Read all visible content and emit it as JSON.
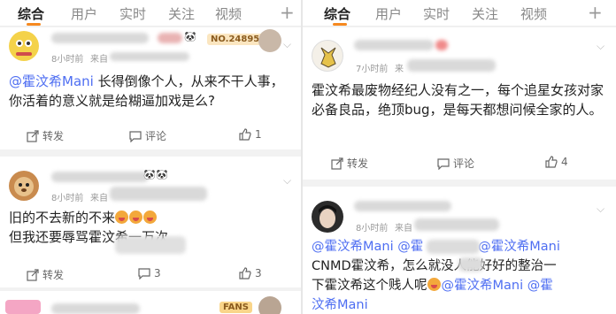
{
  "tabs": [
    "综合",
    "用户",
    "实时",
    "关注",
    "视频"
  ],
  "plus_label": "+",
  "left": {
    "post1": {
      "badge": "NO.248957",
      "time": "8小时前",
      "source": "来自",
      "mention": "@霍汶希Mani",
      "text": " 长得倒像个人，从来不干人事，你活着的意义就是给糊逼加戏是么?",
      "repost": "转发",
      "comment": "评论",
      "likes": "1"
    },
    "post2": {
      "time": "8小时前",
      "source": "来自",
      "line1": "旧的不去新的不来",
      "line2": "但我还要辱骂霍汶希一万次",
      "repost": "转发",
      "comments": "3",
      "likes": "3"
    },
    "post3": {
      "badge": "FANS"
    }
  },
  "right": {
    "post1": {
      "time": "7小时前",
      "source": "来",
      "text": "霍汶希最废物经纪人没有之一，每个追星女孩对家必备良品，绝顶bug，是每天都想问候全家的人。",
      "repost": "转发",
      "comment": "评论",
      "likes": "4"
    },
    "post2": {
      "time": "8小时前",
      "source": "来自",
      "mention1": "@霍汶希Mani",
      "mention2": "@霍",
      "mention3": "@霍汶希Mani",
      "line2": "CNMD霍汶希，怎么就没人能好好的整治一",
      "line3a": "下霍汶希这个贱人呢",
      "mention4": "@霍汶希Mani",
      "mention5": "@霍",
      "line4": "汶希Mani"
    }
  },
  "colors": {
    "accent": "#f6891f",
    "mention": "#4e6ef2"
  }
}
